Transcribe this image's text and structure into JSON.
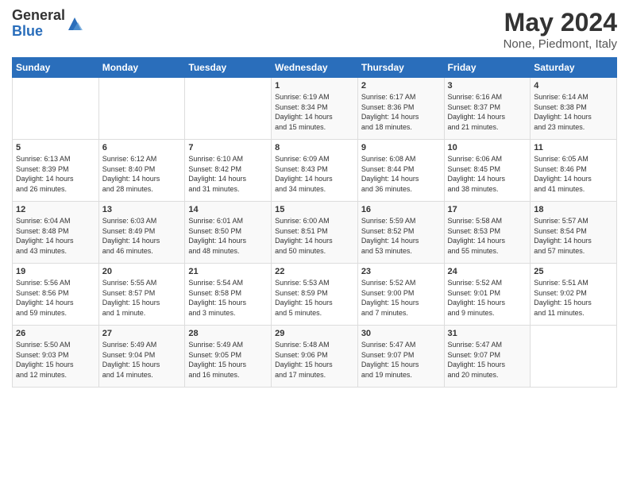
{
  "logo": {
    "general": "General",
    "blue": "Blue"
  },
  "header": {
    "month": "May 2024",
    "location": "None, Piedmont, Italy"
  },
  "days_of_week": [
    "Sunday",
    "Monday",
    "Tuesday",
    "Wednesday",
    "Thursday",
    "Friday",
    "Saturday"
  ],
  "weeks": [
    [
      {
        "day": "",
        "info": ""
      },
      {
        "day": "",
        "info": ""
      },
      {
        "day": "",
        "info": ""
      },
      {
        "day": "1",
        "info": "Sunrise: 6:19 AM\nSunset: 8:34 PM\nDaylight: 14 hours\nand 15 minutes."
      },
      {
        "day": "2",
        "info": "Sunrise: 6:17 AM\nSunset: 8:36 PM\nDaylight: 14 hours\nand 18 minutes."
      },
      {
        "day": "3",
        "info": "Sunrise: 6:16 AM\nSunset: 8:37 PM\nDaylight: 14 hours\nand 21 minutes."
      },
      {
        "day": "4",
        "info": "Sunrise: 6:14 AM\nSunset: 8:38 PM\nDaylight: 14 hours\nand 23 minutes."
      }
    ],
    [
      {
        "day": "5",
        "info": "Sunrise: 6:13 AM\nSunset: 8:39 PM\nDaylight: 14 hours\nand 26 minutes."
      },
      {
        "day": "6",
        "info": "Sunrise: 6:12 AM\nSunset: 8:40 PM\nDaylight: 14 hours\nand 28 minutes."
      },
      {
        "day": "7",
        "info": "Sunrise: 6:10 AM\nSunset: 8:42 PM\nDaylight: 14 hours\nand 31 minutes."
      },
      {
        "day": "8",
        "info": "Sunrise: 6:09 AM\nSunset: 8:43 PM\nDaylight: 14 hours\nand 34 minutes."
      },
      {
        "day": "9",
        "info": "Sunrise: 6:08 AM\nSunset: 8:44 PM\nDaylight: 14 hours\nand 36 minutes."
      },
      {
        "day": "10",
        "info": "Sunrise: 6:06 AM\nSunset: 8:45 PM\nDaylight: 14 hours\nand 38 minutes."
      },
      {
        "day": "11",
        "info": "Sunrise: 6:05 AM\nSunset: 8:46 PM\nDaylight: 14 hours\nand 41 minutes."
      }
    ],
    [
      {
        "day": "12",
        "info": "Sunrise: 6:04 AM\nSunset: 8:48 PM\nDaylight: 14 hours\nand 43 minutes."
      },
      {
        "day": "13",
        "info": "Sunrise: 6:03 AM\nSunset: 8:49 PM\nDaylight: 14 hours\nand 46 minutes."
      },
      {
        "day": "14",
        "info": "Sunrise: 6:01 AM\nSunset: 8:50 PM\nDaylight: 14 hours\nand 48 minutes."
      },
      {
        "day": "15",
        "info": "Sunrise: 6:00 AM\nSunset: 8:51 PM\nDaylight: 14 hours\nand 50 minutes."
      },
      {
        "day": "16",
        "info": "Sunrise: 5:59 AM\nSunset: 8:52 PM\nDaylight: 14 hours\nand 53 minutes."
      },
      {
        "day": "17",
        "info": "Sunrise: 5:58 AM\nSunset: 8:53 PM\nDaylight: 14 hours\nand 55 minutes."
      },
      {
        "day": "18",
        "info": "Sunrise: 5:57 AM\nSunset: 8:54 PM\nDaylight: 14 hours\nand 57 minutes."
      }
    ],
    [
      {
        "day": "19",
        "info": "Sunrise: 5:56 AM\nSunset: 8:56 PM\nDaylight: 14 hours\nand 59 minutes."
      },
      {
        "day": "20",
        "info": "Sunrise: 5:55 AM\nSunset: 8:57 PM\nDaylight: 15 hours\nand 1 minute."
      },
      {
        "day": "21",
        "info": "Sunrise: 5:54 AM\nSunset: 8:58 PM\nDaylight: 15 hours\nand 3 minutes."
      },
      {
        "day": "22",
        "info": "Sunrise: 5:53 AM\nSunset: 8:59 PM\nDaylight: 15 hours\nand 5 minutes."
      },
      {
        "day": "23",
        "info": "Sunrise: 5:52 AM\nSunset: 9:00 PM\nDaylight: 15 hours\nand 7 minutes."
      },
      {
        "day": "24",
        "info": "Sunrise: 5:52 AM\nSunset: 9:01 PM\nDaylight: 15 hours\nand 9 minutes."
      },
      {
        "day": "25",
        "info": "Sunrise: 5:51 AM\nSunset: 9:02 PM\nDaylight: 15 hours\nand 11 minutes."
      }
    ],
    [
      {
        "day": "26",
        "info": "Sunrise: 5:50 AM\nSunset: 9:03 PM\nDaylight: 15 hours\nand 12 minutes."
      },
      {
        "day": "27",
        "info": "Sunrise: 5:49 AM\nSunset: 9:04 PM\nDaylight: 15 hours\nand 14 minutes."
      },
      {
        "day": "28",
        "info": "Sunrise: 5:49 AM\nSunset: 9:05 PM\nDaylight: 15 hours\nand 16 minutes."
      },
      {
        "day": "29",
        "info": "Sunrise: 5:48 AM\nSunset: 9:06 PM\nDaylight: 15 hours\nand 17 minutes."
      },
      {
        "day": "30",
        "info": "Sunrise: 5:47 AM\nSunset: 9:07 PM\nDaylight: 15 hours\nand 19 minutes."
      },
      {
        "day": "31",
        "info": "Sunrise: 5:47 AM\nSunset: 9:07 PM\nDaylight: 15 hours\nand 20 minutes."
      },
      {
        "day": "",
        "info": ""
      }
    ]
  ]
}
